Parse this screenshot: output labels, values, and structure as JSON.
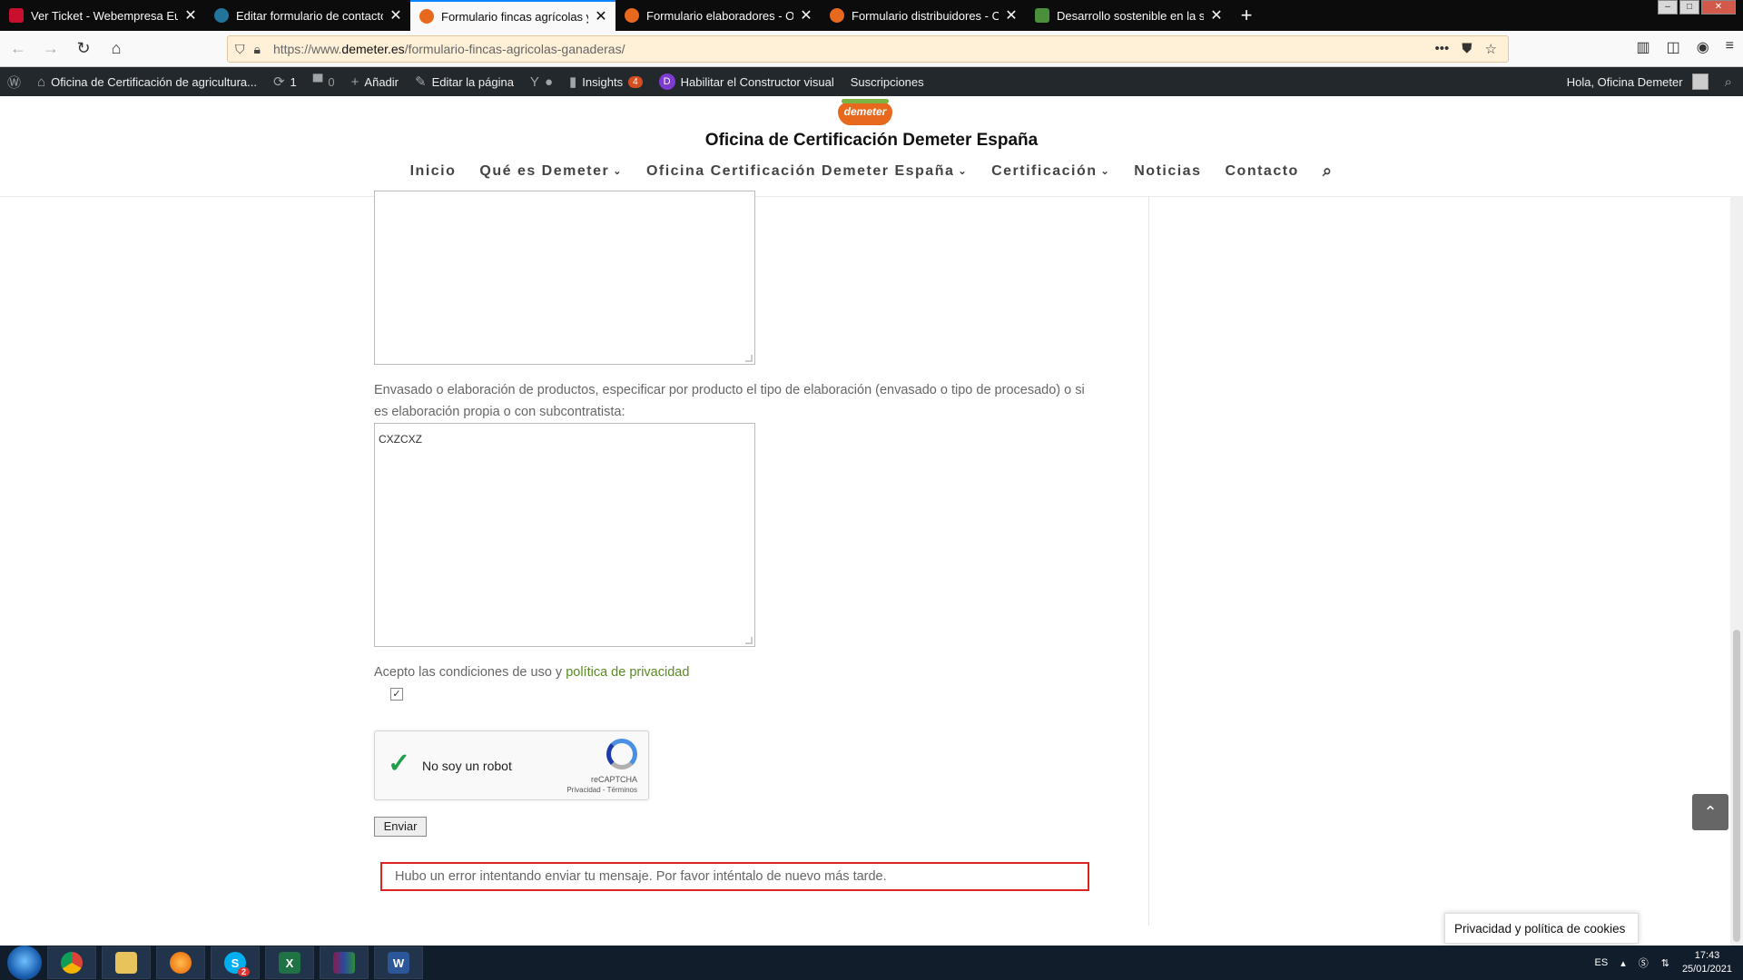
{
  "browser": {
    "tabs": [
      {
        "label": "Ver Ticket - Webempresa Europ",
        "favicon_color": "#c8102e",
        "active": false
      },
      {
        "label": "Editar formulario de contacto",
        "favicon_color": "#21759b",
        "active": false
      },
      {
        "label": "Formulario fincas agrícolas y/o",
        "favicon_color": "#e8691d",
        "active": true
      },
      {
        "label": "Formulario elaboradores - Ofic",
        "favicon_color": "#e8691d",
        "active": false
      },
      {
        "label": "Formulario distribuidores - Ofi",
        "favicon_color": "#e8691d",
        "active": false
      },
      {
        "label": "Desarrollo sostenible en la sier",
        "favicon_color": "#4a8f3a",
        "active": false
      }
    ],
    "url_prefix": "https://www.",
    "url_domain": "demeter.es",
    "url_path": "/formulario-fincas-agricolas-ganaderas/"
  },
  "wpbar": {
    "site_name": "Oficina de Certificación de agricultura...",
    "updates_count": "1",
    "comments_count": "0",
    "add_label": "Añadir",
    "edit_label": "Editar la página",
    "insights_label": "Insights",
    "insights_badge": "4",
    "builder_label": "Habilitar el Constructor visual",
    "subscriptions_label": "Suscripciones",
    "greeting": "Hola, Oficina Demeter"
  },
  "site": {
    "logo_text": "demeter",
    "title": "Oficina de Certificación Demeter España",
    "nav": [
      {
        "label": "Inicio",
        "has_dropdown": false
      },
      {
        "label": "Qué es Demeter",
        "has_dropdown": true
      },
      {
        "label": "Oficina Certificación Demeter España",
        "has_dropdown": true
      },
      {
        "label": "Certificación",
        "has_dropdown": true
      },
      {
        "label": "Noticias",
        "has_dropdown": false
      },
      {
        "label": "Contacto",
        "has_dropdown": false
      }
    ]
  },
  "form": {
    "elaboration_label": "Envasado o elaboración de productos, especificar por producto el tipo de elaboración (envasado o tipo de procesado) o si es elaboración propia o con subcontratista:",
    "elaboration_value": "CXZCXZ",
    "accept_text": "Acepto las condiciones de uso y ",
    "privacy_link": "política de privacidad",
    "accept_checked": true,
    "captcha_label": "No soy un robot",
    "captcha_brand": "reCAPTCHA",
    "captcha_terms": "Privacidad - Términos",
    "submit_label": "Enviar",
    "error_message": "Hubo un error intentando enviar tu mensaje. Por favor inténtalo de nuevo más tarde."
  },
  "cookies_label": "Privacidad y política de cookies",
  "taskbar": {
    "language": "ES",
    "time": "17:43",
    "date": "25/01/2021",
    "skype_badge": "2"
  }
}
